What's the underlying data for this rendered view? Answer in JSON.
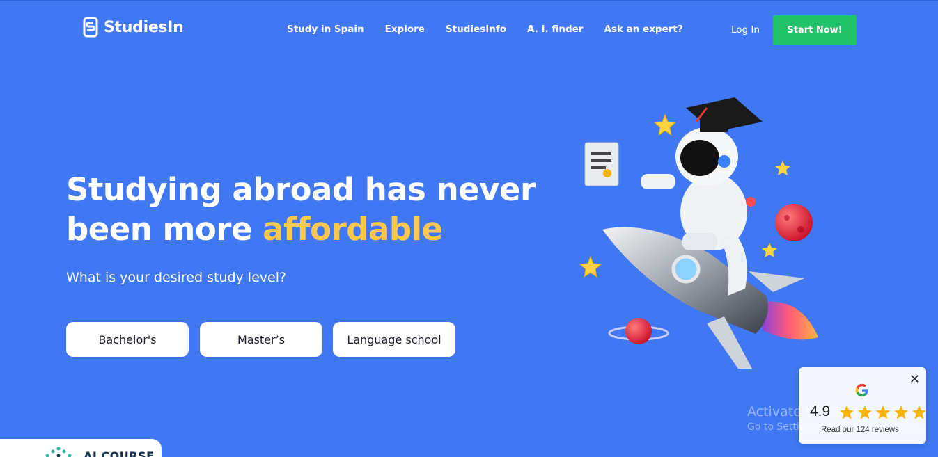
{
  "brand": {
    "name": "StudiesIn"
  },
  "nav": {
    "links": [
      "Study in Spain",
      "Explore",
      "StudiesInfo",
      "A. I. finder",
      "Ask an expert?"
    ],
    "login": "Log In",
    "cta": "Start Now!"
  },
  "hero": {
    "title_part1": "Studying abroad has never been more",
    "title_accent": "affordable",
    "question": "What is your desired study level?",
    "levels": [
      "Bachelor's",
      "Master’s",
      "Language school"
    ]
  },
  "watermark": {
    "title": "Activate Windows",
    "subtitle": "Go to Settings to activate Windows."
  },
  "review": {
    "rating": "4.9",
    "stars": 5,
    "link": "Read our 124 reviews",
    "close": "✕"
  },
  "bottom_card": {
    "text": "AI COURSE"
  },
  "colors": {
    "background": "#4077f2",
    "accent": "#ffc84a",
    "cta": "#22c26b",
    "star": "#f8b400"
  }
}
